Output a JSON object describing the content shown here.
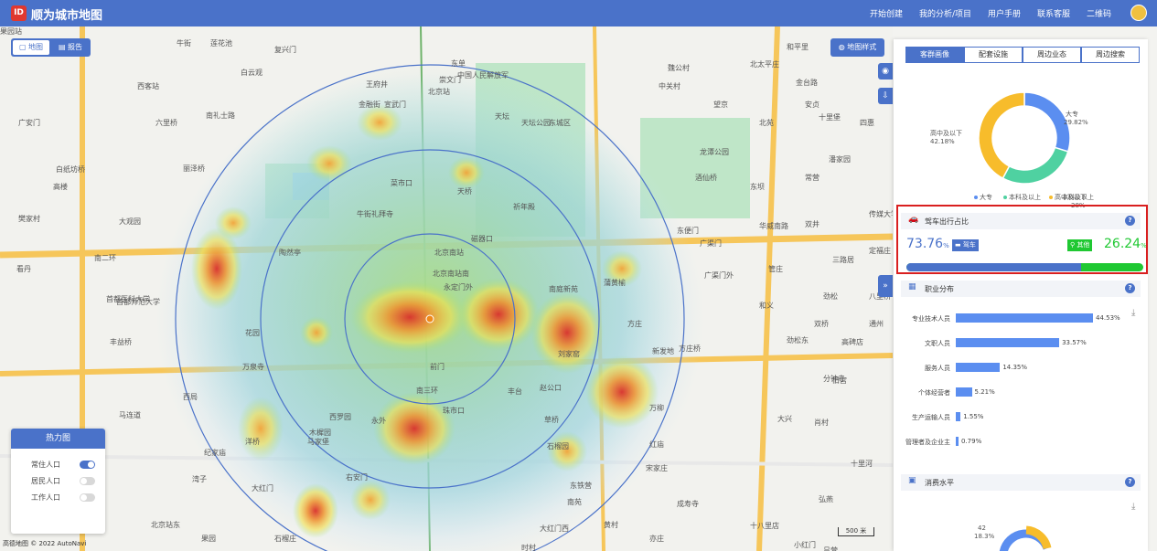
{
  "app": {
    "logo": "ID",
    "title": "顺为城市地图"
  },
  "nav": [
    "开始创建",
    "我的分析/项目",
    "用户手册",
    "联系客服",
    "二维码"
  ],
  "map_controls": {
    "map_label": "地图",
    "report_label": "报告",
    "style_label": "地图样式"
  },
  "heat_legend": {
    "title": "热力图",
    "layers": [
      {
        "label": "常住人口",
        "on": true
      },
      {
        "label": "居民人口",
        "on": false
      },
      {
        "label": "工作人口",
        "on": false
      }
    ]
  },
  "map_labels": [
    "牛街",
    "南礼士路",
    "中国人民解放军",
    "广安门",
    "白纸坊桥",
    "大观园",
    "首都医科大学",
    "南二环",
    "陶然亭",
    "北京南站",
    "永定门外",
    "天坛",
    "天坛公园",
    "前门",
    "珠市口",
    "东城区",
    "龙潭公园",
    "广渠门",
    "磁器口",
    "蒲黄榆",
    "方庄",
    "方庄桥",
    "木樨园",
    "玉泉营桥",
    "大红门",
    "分钟寺",
    "华威南路",
    "劲松",
    "潘家园",
    "十里河",
    "首都师范大学",
    "右安门",
    "马家堡",
    "刘家窑",
    "宋家庄",
    "成寿寺",
    "西罗园",
    "赵公口",
    "北京南站南",
    "永外",
    "石榴园",
    "洋桥",
    "纪家庙",
    "南三环",
    "丰台",
    "新发地",
    "和义",
    "大兴",
    "三路居",
    "东铁营",
    "草桥",
    "花园",
    "红庙",
    "北京站",
    "崇文门",
    "东单",
    "王府井",
    "宣武门",
    "菜市口",
    "牛街礼拜寺",
    "天桥",
    "祈年殿",
    "金台路",
    "十里堡",
    "金融街",
    "复兴门",
    "白云观",
    "莲花池",
    "西客站",
    "六里桥",
    "丽泽桥",
    "高楼",
    "樊家村",
    "看丹",
    "丰益桥",
    "万泉寺",
    "西局",
    "马连道",
    "湾子",
    "北京站东",
    "东便门",
    "广渠门外",
    "双井",
    "劲松东",
    "弘燕",
    "十八里店",
    "吕营",
    "小红门",
    "肖村",
    "旧宫",
    "亦庄",
    "黄村",
    "南苑",
    "大红门西",
    "时村",
    "果园",
    "石榴庄",
    "南庭新苑",
    "万柳",
    "中关村",
    "魏公村",
    "北太平庄",
    "和平里",
    "安贞",
    "北苑",
    "望京",
    "酒仙桥",
    "东坝",
    "常营",
    "管庄",
    "双桥",
    "高碑店",
    "四惠",
    "传媒大学",
    "定福庄",
    "八里桥",
    "通州",
    "果园站"
  ],
  "panel": {
    "tabs": [
      "客群画像",
      "配套设施",
      "周边业态",
      "周边搜索"
    ],
    "education": {
      "segments": [
        {
          "label": "大专",
          "value": 29.82,
          "color": "#5b8ef0"
        },
        {
          "label": "本科及以上",
          "value": 28.0,
          "color": "#4fd1a1"
        },
        {
          "label": "高中及以下",
          "value": 42.18,
          "color": "#f7bc2b"
        }
      ],
      "labels": {
        "dazhuan": "大专",
        "dazhuan_pct": "29.82%",
        "benke": "本科及以上",
        "benke_pct": "28%",
        "gaozhong": "高中及以下",
        "gaozhong_pct": "42.18%"
      },
      "legend": [
        "大专",
        "本科及以上",
        "高中及以下"
      ]
    },
    "commute": {
      "title": "驾车出行占比",
      "car_value": "73.76",
      "car_unit": "%",
      "car_label": "驾车",
      "other_label": "其他",
      "other_value": "26.24",
      "other_unit": "%",
      "car_share": 0.7376,
      "car_color": "#4a72c9",
      "other_color": "#1fc832"
    },
    "occupation": {
      "title": "职业分布",
      "items": [
        {
          "label": "专业技术人员",
          "value": 44.53,
          "text": "44.53%"
        },
        {
          "label": "文职人员",
          "value": 33.57,
          "text": "33.57%"
        },
        {
          "label": "服务人员",
          "value": 14.35,
          "text": "14.35%"
        },
        {
          "label": "个体经营者",
          "value": 5.21,
          "text": "5.21%"
        },
        {
          "label": "生产运输人员",
          "value": 1.55,
          "text": "1.55%"
        },
        {
          "label": "管理者及企业主",
          "value": 0.79,
          "text": "0.79%"
        }
      ]
    },
    "consumption": {
      "title": "消费水平",
      "partial_labels": [
        "42",
        "18.3%"
      ]
    }
  },
  "copyright": "高德地图 © 2022 AutoNavi",
  "scale": "500 米"
}
